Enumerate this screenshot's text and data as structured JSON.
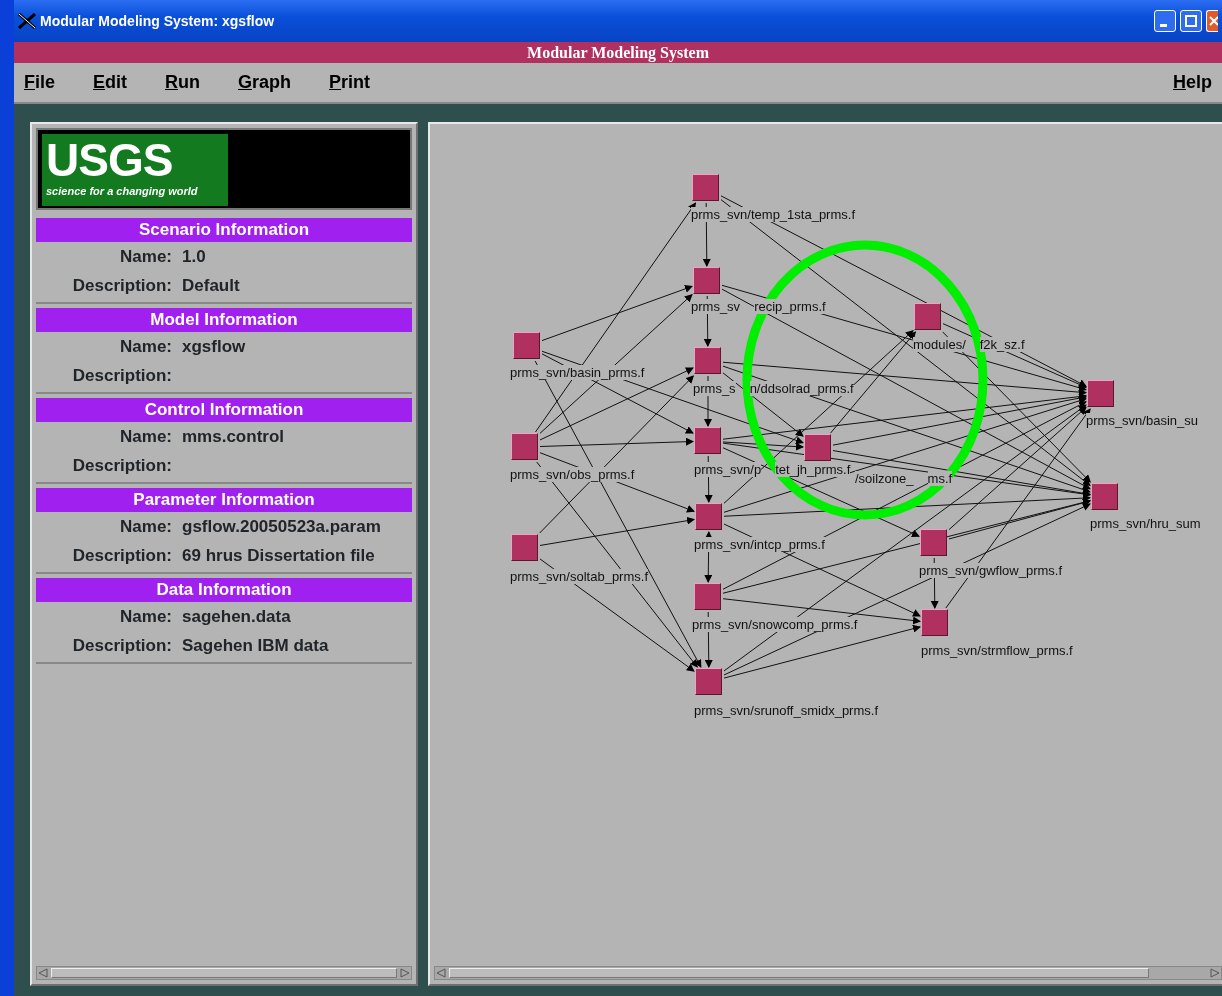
{
  "window": {
    "title": "Modular Modeling System:  xgsflow"
  },
  "app_banner": "Modular Modeling System",
  "menu": [
    {
      "label": "File"
    },
    {
      "label": "Edit"
    },
    {
      "label": "Run"
    },
    {
      "label": "Graph"
    },
    {
      "label": "Print"
    },
    {
      "label": "Help"
    }
  ],
  "logo": {
    "wordmark": "USGS",
    "tagline": "science for a changing world"
  },
  "sections": [
    {
      "title": "Scenario Information",
      "rows": [
        {
          "label": "Name:",
          "value": "1.0"
        },
        {
          "label": "Description:",
          "value": "Default"
        }
      ]
    },
    {
      "title": "Model Information",
      "rows": [
        {
          "label": "Name:",
          "value": "xgsflow"
        },
        {
          "label": "Description:"
        }
      ]
    },
    {
      "title": "Control Information",
      "rows": [
        {
          "label": "Name:",
          "value": "mms.control"
        },
        {
          "label": "Description:"
        }
      ]
    },
    {
      "title": "Parameter Information",
      "rows": [
        {
          "label": "Name:",
          "value": "gsflow.20050523a.param"
        },
        {
          "label": "Description:",
          "value": "69 hrus Dissertation file"
        }
      ]
    },
    {
      "title": "Data Information",
      "rows": [
        {
          "label": "Name:",
          "value": "sagehen.data"
        },
        {
          "label": "Description:",
          "value": "Sagehen IBM data"
        }
      ]
    }
  ],
  "graph": {
    "nodes": [
      {
        "label_parts": [
          "prms_svn/temp_1sta_prms.f"
        ]
      },
      {
        "label_parts": [
          "prms_sv",
          "recip_prms.f"
        ]
      },
      {
        "label_parts": [
          "prms_s",
          "n/ddsolrad_prms.f"
        ]
      },
      {
        "label_parts": [
          "prms_svn/p",
          "tet_jh_prms.f"
        ]
      },
      {
        "label_parts": [
          "prms_svn/intcp_prms.f"
        ]
      },
      {
        "label_parts": [
          "prms_svn/snowcomp_prms.f"
        ]
      },
      {
        "label_parts": [
          "prms_svn/srunoff_smidx_prms.f"
        ]
      },
      {
        "label_parts": [
          "prms_svn/basin_prms.f"
        ]
      },
      {
        "label_parts": [
          "prms_svn/obs_prms.f"
        ]
      },
      {
        "label_parts": [
          "prms_svn/soltab_prms.f"
        ]
      },
      {
        "label_parts": [
          "modules/",
          "f2k_sz.f"
        ]
      },
      {
        "label_parts": [
          "/soilzone_",
          "ms.f"
        ]
      },
      {
        "label_parts": [
          "prms_svn/gwflow_prms.f"
        ]
      },
      {
        "label_parts": [
          "prms_svn/strmflow_prms.f"
        ]
      },
      {
        "label_parts": [
          "prms_svn/basin_su"
        ]
      },
      {
        "label_parts": [
          "prms_svn/hru_sum"
        ]
      }
    ],
    "highlight": true
  }
}
